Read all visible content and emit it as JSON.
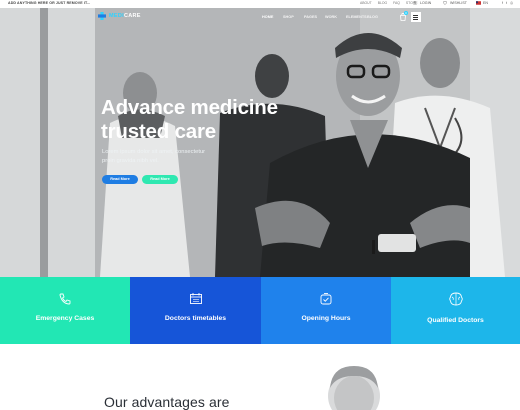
{
  "topbar": {
    "tagline": "ADD ANYTHING HERE OR JUST REMOVE IT...",
    "links": [
      "ABOUT",
      "BLOG",
      "FAQ",
      "STORE"
    ],
    "account_label": "LOGIN",
    "wishlist_label": "WISHLIST",
    "currency_label": "EN"
  },
  "brand": {
    "name_part1": "MEDI",
    "name_part2": "CARE"
  },
  "nav": {
    "items": [
      "HOME",
      "SHOP",
      "PAGES",
      "WORK",
      "ELEMENTS",
      "BLOG"
    ],
    "cart_count": "0"
  },
  "hero": {
    "title_line1": "Advance medicine",
    "title_line2": "trusted care",
    "subtitle": "Lorem ipsum dolor sit amet, consectetur proin gravida nibh vel.",
    "primary_button": "Read More",
    "secondary_button": "Read More"
  },
  "features": [
    {
      "label": "Emergency Cases",
      "icon": "phone-icon",
      "color": "#22e7b4"
    },
    {
      "label": "Doctors timetables",
      "icon": "calendar-icon",
      "color": "#1655d8"
    },
    {
      "label": "Opening Hours",
      "icon": "clock-icon",
      "color": "#1f82ec"
    },
    {
      "label": "Qualified Doctors",
      "icon": "brain-icon",
      "color": "#1db6ea"
    }
  ],
  "advantages": {
    "title": "Our advantages are"
  },
  "colors": {
    "accent": "#2fd3ff",
    "primary": "#1f7de3",
    "mint": "#2fe8b1"
  }
}
